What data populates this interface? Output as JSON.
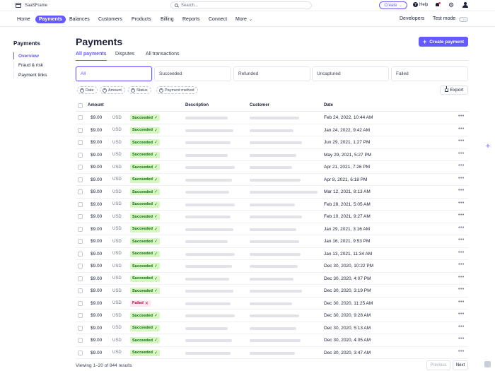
{
  "app": {
    "name": "SaaSFrame"
  },
  "search": {
    "placeholder": "Search..."
  },
  "topbar": {
    "create_label": "Create",
    "help_label": "Help"
  },
  "nav": {
    "items": [
      "Home",
      "Payments",
      "Balances",
      "Customers",
      "Products",
      "Billing",
      "Reports",
      "Connect",
      "More"
    ],
    "active": "Payments",
    "developers_label": "Developers",
    "test_mode_label": "Test mode"
  },
  "sidebar": {
    "title": "Payments",
    "items": [
      "Overview",
      "Fraud & risk",
      "Payment links"
    ],
    "active": "Overview"
  },
  "page": {
    "title": "Payments",
    "create_payment_label": "Create payment"
  },
  "tabs": [
    "All payments",
    "Disputes",
    "All transactions"
  ],
  "status_filters": [
    "All",
    "Succeeded",
    "Refunded",
    "Uncaptured",
    "Failed"
  ],
  "filter_chips": [
    "Date",
    "Amount",
    "Status",
    "Payment method"
  ],
  "export_label": "Export",
  "table": {
    "headers": [
      "Amount",
      "Description",
      "Customer",
      "Date"
    ],
    "rows": [
      {
        "amount": "$9.00",
        "currency": "USD",
        "status": "Succeeded",
        "date": "Feb 24, 2022, 10:44 AM"
      },
      {
        "amount": "$9.00",
        "currency": "USD",
        "status": "Succeeded",
        "date": "Jan 24, 2022, 9:42 AM"
      },
      {
        "amount": "$9.00",
        "currency": "USD",
        "status": "Succeeded",
        "date": "Jun 29, 2021, 1:27 PM"
      },
      {
        "amount": "$9.00",
        "currency": "USD",
        "status": "Succeeded",
        "date": "May 29, 2021, 5:27 PM"
      },
      {
        "amount": "$9.00",
        "currency": "USD",
        "status": "Succeeded",
        "date": "Apr 21, 2021, 7:26 PM"
      },
      {
        "amount": "$9.00",
        "currency": "USD",
        "status": "Succeeded",
        "date": "Apr 8, 2021, 6:18 PM"
      },
      {
        "amount": "$9.00",
        "currency": "USD",
        "status": "Succeeded",
        "date": "Mar 12, 2021, 8:13 AM"
      },
      {
        "amount": "$9.00",
        "currency": "USD",
        "status": "Succeeded",
        "date": "Feb 28, 2021, 5:05 AM"
      },
      {
        "amount": "$9.00",
        "currency": "USD",
        "status": "Succeeded",
        "date": "Feb 10, 2021, 9:27 AM"
      },
      {
        "amount": "$9.00",
        "currency": "USD",
        "status": "Succeeded",
        "date": "Jan 29, 2021, 3:16 AM"
      },
      {
        "amount": "$9.00",
        "currency": "USD",
        "status": "Succeeded",
        "date": "Jan 16, 2021, 9:53 PM"
      },
      {
        "amount": "$9.00",
        "currency": "USD",
        "status": "Succeeded",
        "date": "Jan 13, 2021, 11:34 AM"
      },
      {
        "amount": "$9.00",
        "currency": "USD",
        "status": "Succeeded",
        "date": "Dec 30, 2020, 10:22 PM"
      },
      {
        "amount": "$9.00",
        "currency": "USD",
        "status": "Succeeded",
        "date": "Dec 30, 2020, 4:07 PM"
      },
      {
        "amount": "$9.00",
        "currency": "USD",
        "status": "Succeeded",
        "date": "Dec 30, 2020, 3:19 PM"
      },
      {
        "amount": "$9.00",
        "currency": "USD",
        "status": "Failed",
        "date": "Dec 30, 2020, 11:25 AM"
      },
      {
        "amount": "$9.00",
        "currency": "USD",
        "status": "Succeeded",
        "date": "Dec 30, 2020, 9:28 AM"
      },
      {
        "amount": "$9.00",
        "currency": "USD",
        "status": "Succeeded",
        "date": "Dec 30, 2020, 5:13 AM"
      },
      {
        "amount": "$9.00",
        "currency": "USD",
        "status": "Succeeded",
        "date": "Dec 30, 2020, 4:05 AM"
      },
      {
        "amount": "$9.00",
        "currency": "USD",
        "status": "Succeeded",
        "date": "Dec 30, 2020, 3:47 AM"
      }
    ]
  },
  "footer": {
    "results_text": "Viewing 1–20 of 844 results",
    "previous_label": "Previous",
    "next_label": "Next"
  },
  "colors": {
    "accent": "#635bff",
    "success_bg": "#d7f7c2",
    "success_text": "#05690d",
    "failed_bg": "#ffe7f2",
    "failed_text": "#b3093c"
  },
  "icons": {
    "brand": "app-frame-icon",
    "search": "search-icon",
    "help": "help-icon",
    "notifications": "bell-icon",
    "settings": "gear-icon",
    "account": "user-icon",
    "export": "export-icon",
    "row_actions": "more-icon"
  }
}
